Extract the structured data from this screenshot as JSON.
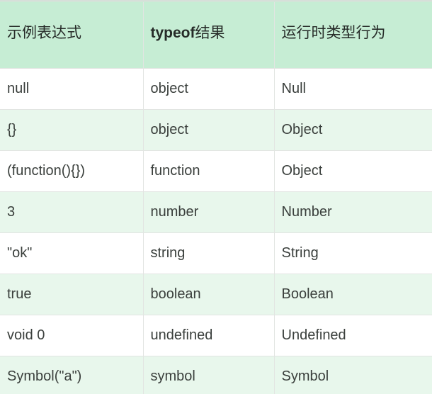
{
  "table": {
    "headers": [
      {
        "text": "示例表达式",
        "bold_prefix": ""
      },
      {
        "text": "结果",
        "bold_prefix": "typeof"
      },
      {
        "text": "运行时类型行为",
        "bold_prefix": ""
      }
    ],
    "rows": [
      {
        "expression": "null",
        "typeof_result": "object",
        "runtime_type": "Null"
      },
      {
        "expression": "{}",
        "typeof_result": "object",
        "runtime_type": "Object"
      },
      {
        "expression": "(function(){})",
        "typeof_result": "function",
        "runtime_type": "Object"
      },
      {
        "expression": "3",
        "typeof_result": "number",
        "runtime_type": "Number"
      },
      {
        "expression": "\"ok\"",
        "typeof_result": "string",
        "runtime_type": "String"
      },
      {
        "expression": "true",
        "typeof_result": "boolean",
        "runtime_type": "Boolean"
      },
      {
        "expression": "void 0",
        "typeof_result": "undefined",
        "runtime_type": "Undefined"
      },
      {
        "expression": "Symbol(\"a\")",
        "typeof_result": "symbol",
        "runtime_type": "Symbol"
      }
    ]
  },
  "colors": {
    "header_background": "#c6edd4",
    "stripe_background": "#e8f7ec",
    "row_background": "#ffffff",
    "border": "#e2e5e2",
    "header_text": "#262b28",
    "cell_text": "#3a3f3c"
  }
}
